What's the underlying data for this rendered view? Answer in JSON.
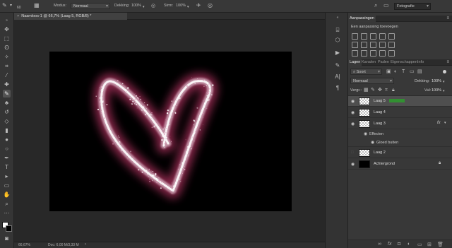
{
  "options_bar": {
    "brush_size": "60",
    "mode_label": "Modus:",
    "mode_value": "Normaal",
    "opacity_label": "Dekking:",
    "opacity_value": "100%",
    "flow_label": "Strm:",
    "flow_value": "100%",
    "workspace": "Fotografie"
  },
  "document": {
    "tab_title": "Naamloos-1 @ 66,7% (Laag 5, RGB/8) *",
    "canvas_color": "#000000",
    "stroke_color": "#f2dbe6",
    "glow_color": "#b0305f"
  },
  "status": {
    "zoom": "66,67%",
    "doc_info": "Doc: 6,00 M/3,33 M"
  },
  "adjustments": {
    "tab_label": "Aanpassingen",
    "subtitle": "Een aanpassing toevoegen"
  },
  "layers_panel": {
    "tabs": [
      "Lagen",
      "Kanalen",
      "Paden",
      "Eigenschappen",
      "Info"
    ],
    "filter_label": "Soort",
    "blend_mode": "Normaal",
    "opacity_label": "Dekking:",
    "opacity_value": "100%",
    "lock_label": "Vergr.:",
    "fill_label": "Vul:",
    "fill_value": "100%",
    "layers": [
      {
        "name": "Laag 5",
        "selected": true
      },
      {
        "name": "Laag 4",
        "selected": false
      },
      {
        "name": "Laag 3",
        "selected": false,
        "fx": "fx"
      },
      {
        "name": "Effecten",
        "sub": true
      },
      {
        "name": "Gloed buiten",
        "sub": true
      },
      {
        "name": "Laag 2",
        "selected": false
      },
      {
        "name": "Achtergrond",
        "selected": false
      }
    ]
  }
}
